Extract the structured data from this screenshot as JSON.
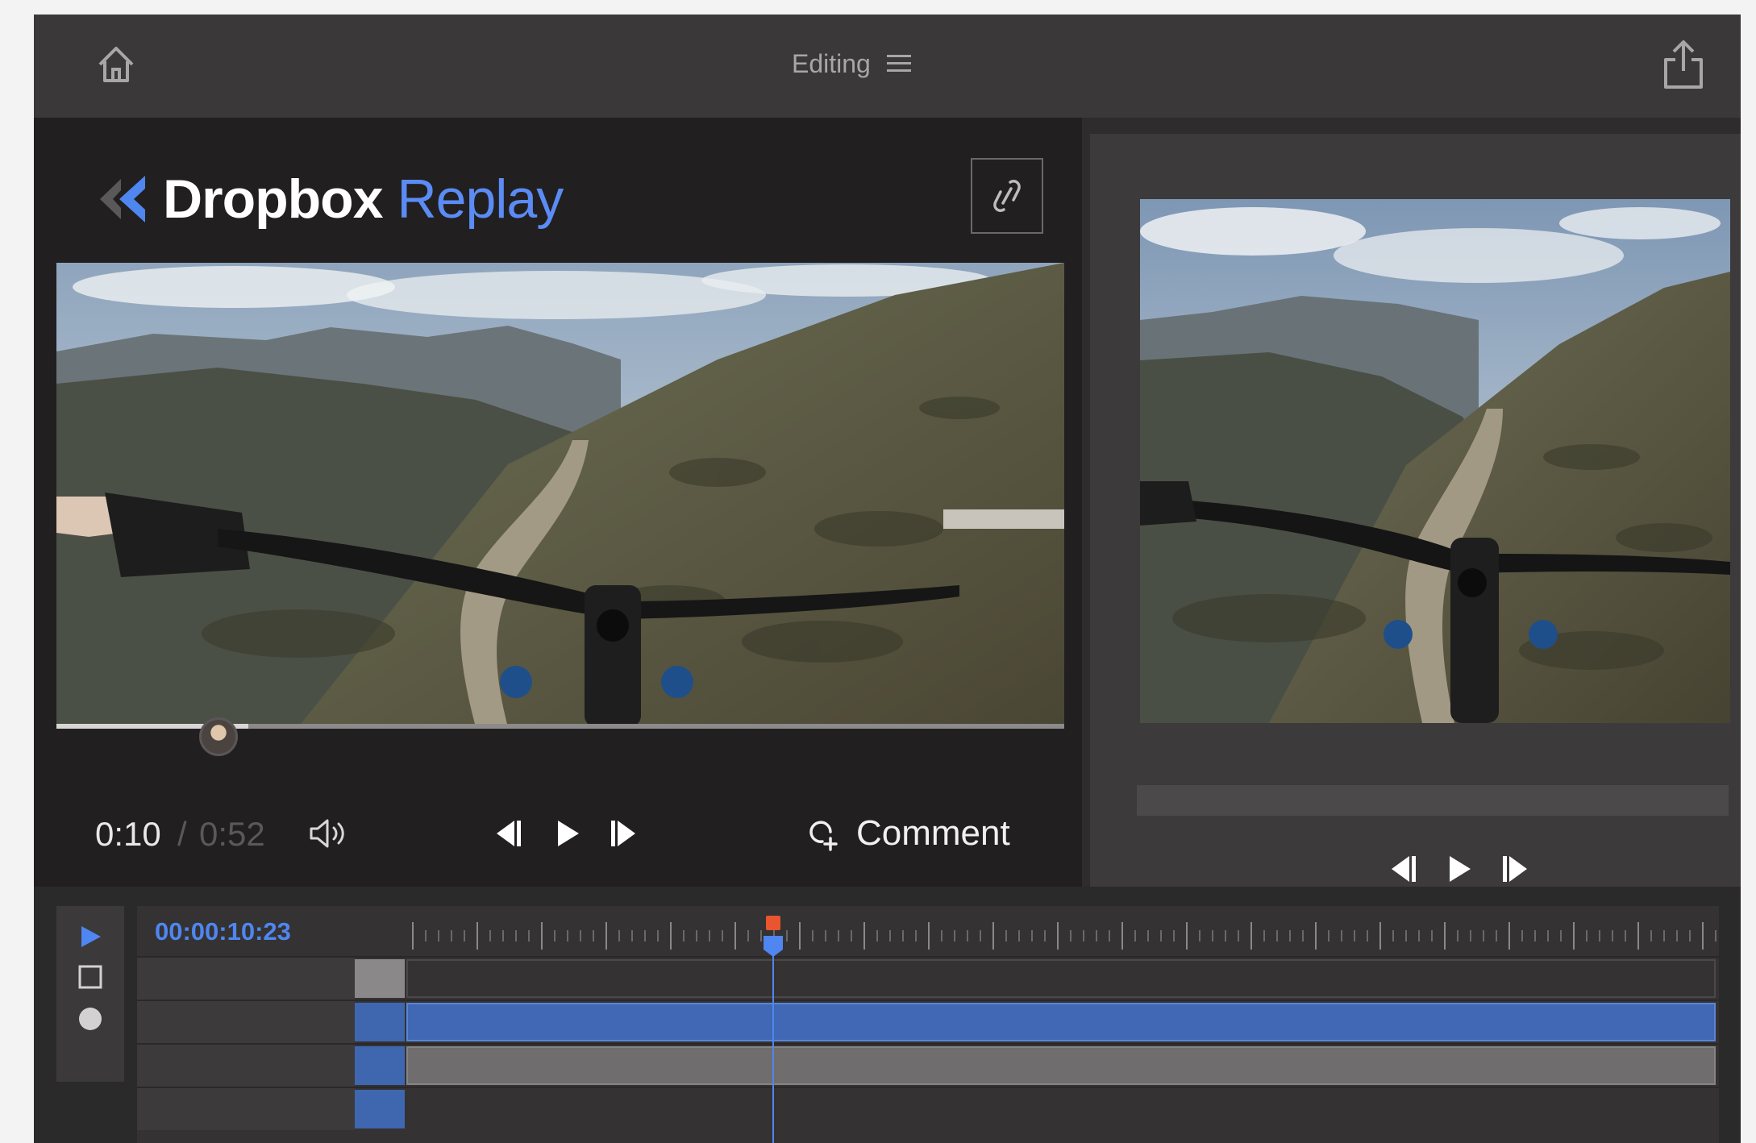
{
  "header": {
    "mode_label": "Editing",
    "icons": {
      "home": "home-icon",
      "menu": "hamburger-menu-icon",
      "share": "share-icon"
    }
  },
  "brand": {
    "word1": "Dropbox",
    "word2": "Replay",
    "logo": "dropbox-replay-logo-icon",
    "accent_color": "#5b8cf5"
  },
  "player": {
    "link_icon": "link-icon",
    "time_current": "0:10",
    "time_separator": "/",
    "time_total": "0:52",
    "progress_fraction": 0.19,
    "controls": {
      "volume": "volume-icon",
      "prev_frame": "step-back-icon",
      "play": "play-icon",
      "next_frame": "step-forward-icon"
    },
    "comment_label": "Comment",
    "comment_icon": "add-comment-icon"
  },
  "preview": {
    "controls": {
      "prev_frame": "step-back-icon",
      "play": "play-icon",
      "next_frame": "step-forward-icon"
    }
  },
  "timeline": {
    "timecode": "00:00:10:23",
    "tools": [
      "play-icon",
      "stop-icon",
      "record-icon"
    ],
    "playhead_color": "#4f86f0",
    "playhead_marker_color": "#e8552e",
    "clip_color_video": "#4068b4",
    "clip_color_audio": "#6f6d6e"
  }
}
